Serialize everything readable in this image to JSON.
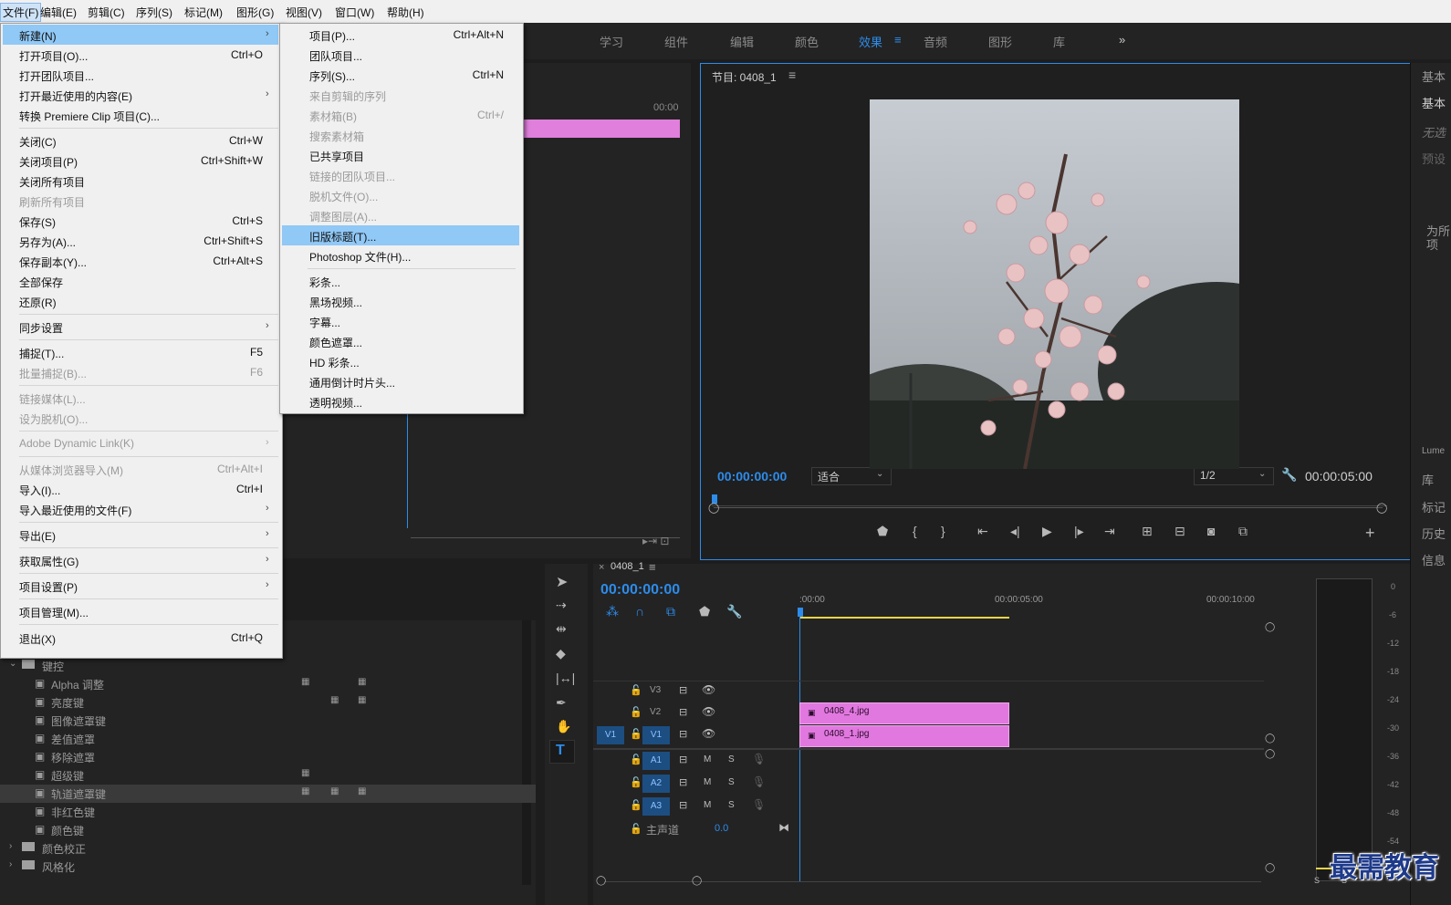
{
  "menubar": {
    "items": [
      "文件(F)",
      "编辑(E)",
      "剪辑(C)",
      "序列(S)",
      "标记(M)",
      "图形(G)",
      "视图(V)",
      "窗口(W)",
      "帮助(H)"
    ]
  },
  "workspace_tabs": [
    "学习",
    "组件",
    "编辑",
    "颜色",
    "效果",
    "音频",
    "图形",
    "库"
  ],
  "workspace_more": "»",
  "file_menu": {
    "items": [
      {
        "label": "新建(N)",
        "shortcut": "",
        "arrow": "›"
      },
      {
        "label": "打开项目(O)...",
        "shortcut": "Ctrl+O"
      },
      {
        "label": "打开团队项目..."
      },
      {
        "label": "打开最近使用的内容(E)",
        "arrow": "›"
      },
      {
        "label": "转换 Premiere Clip 项目(C)..."
      },
      {
        "label": "关闭(C)",
        "shortcut": "Ctrl+W"
      },
      {
        "label": "关闭项目(P)",
        "shortcut": "Ctrl+Shift+W"
      },
      {
        "label": "关闭所有项目"
      },
      {
        "label": "刷新所有项目"
      },
      {
        "label": "保存(S)",
        "shortcut": "Ctrl+S"
      },
      {
        "label": "另存为(A)...",
        "shortcut": "Ctrl+Shift+S"
      },
      {
        "label": "保存副本(Y)...",
        "shortcut": "Ctrl+Alt+S"
      },
      {
        "label": "全部保存"
      },
      {
        "label": "还原(R)"
      },
      {
        "label": "同步设置",
        "arrow": "›"
      },
      {
        "label": "捕捉(T)...",
        "shortcut": "F5"
      },
      {
        "label": "批量捕捉(B)...",
        "shortcut": "F6"
      },
      {
        "label": "链接媒体(L)..."
      },
      {
        "label": "设为脱机(O)..."
      },
      {
        "label": "Adobe Dynamic Link(K)",
        "arrow": "›"
      },
      {
        "label": "从媒体浏览器导入(M)",
        "shortcut": "Ctrl+Alt+I"
      },
      {
        "label": "导入(I)...",
        "shortcut": "Ctrl+I"
      },
      {
        "label": "导入最近使用的文件(F)",
        "arrow": "›"
      },
      {
        "label": "导出(E)",
        "arrow": "›"
      },
      {
        "label": "获取属性(G)",
        "arrow": "›"
      },
      {
        "label": "项目设置(P)",
        "arrow": "›"
      },
      {
        "label": "项目管理(M)..."
      },
      {
        "label": "退出(X)",
        "shortcut": "Ctrl+Q"
      }
    ]
  },
  "new_submenu": {
    "items": [
      {
        "label": "项目(P)...",
        "shortcut": "Ctrl+Alt+N"
      },
      {
        "label": "团队项目..."
      },
      {
        "label": "序列(S)...",
        "shortcut": "Ctrl+N"
      },
      {
        "label": "来自剪辑的序列"
      },
      {
        "label": "素材箱(B)",
        "shortcut": "Ctrl+/"
      },
      {
        "label": "搜索素材箱"
      },
      {
        "label": "已共享项目"
      },
      {
        "label": "链接的团队项目..."
      },
      {
        "label": "脱机文件(O)..."
      },
      {
        "label": "调整图层(A)..."
      },
      {
        "label": "旧版标题(T)..."
      },
      {
        "label": "Photoshop 文件(H)..."
      },
      {
        "label": "彩条..."
      },
      {
        "label": "黑场视频..."
      },
      {
        "label": "字幕..."
      },
      {
        "label": "颜色遮罩..."
      },
      {
        "label": "HD 彩条..."
      },
      {
        "label": "通用倒计时片头..."
      },
      {
        "label": "透明视频..."
      }
    ]
  },
  "source": {
    "timecode": "00:00"
  },
  "program": {
    "title": "节目: 0408_1",
    "timecode_current": "00:00:00:00",
    "fit": "适合",
    "resolution": "1/2",
    "timecode_duration": "00:00:05:00"
  },
  "timeline": {
    "tab": "0408_1",
    "timecode": "00:00:00:00",
    "ruler": [
      ":00:00",
      "00:00:05:00",
      "00:00:10:00"
    ],
    "tracks": {
      "v3": "V3",
      "v2": "V2",
      "v1": "V1",
      "src_v1": "V1",
      "a1": "A1",
      "a2": "A2",
      "a3": "A3",
      "m": "M",
      "s": "S",
      "master": "主声道",
      "master_value": "0.0"
    },
    "clips": [
      "0408_4.jpg",
      "0408_1.jpg"
    ]
  },
  "effects": {
    "rows": [
      {
        "label": "键控",
        "folder": true
      },
      {
        "label": "Alpha 调整"
      },
      {
        "label": "亮度键"
      },
      {
        "label": "图像遮罩键"
      },
      {
        "label": "差值遮罩"
      },
      {
        "label": "移除遮罩"
      },
      {
        "label": "超级键"
      },
      {
        "label": "轨道遮罩键"
      },
      {
        "label": "非红色键"
      },
      {
        "label": "颜色键"
      },
      {
        "label": "颜色校正",
        "folder": true
      },
      {
        "label": "风格化",
        "folder": true
      }
    ]
  },
  "meter_scale": [
    "0",
    "-6",
    "-12",
    "-18",
    "-24",
    "-30",
    "-36",
    "-42",
    "-48",
    "-54"
  ],
  "meter_labels": [
    "S",
    "S"
  ],
  "right_panel": [
    "基本",
    "基本",
    "无选",
    "预设",
    "为所",
    "项",
    "Lume",
    "库",
    "标记",
    "历史",
    "信息"
  ],
  "watermark": "最需教育"
}
